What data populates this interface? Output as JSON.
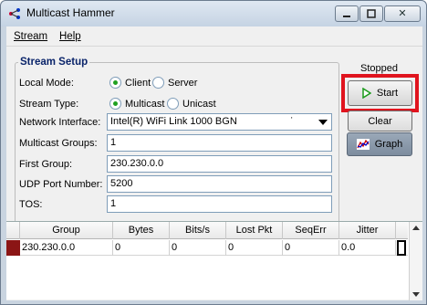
{
  "window": {
    "title": "Multicast Hammer",
    "close_label": "✕"
  },
  "menu": {
    "stream": "Stream",
    "help": "Help"
  },
  "stream_setup": {
    "title": "Stream Setup",
    "local_mode": {
      "label": "Local Mode:",
      "options": [
        "Client",
        "Server"
      ],
      "selected": "Client"
    },
    "stream_type": {
      "label": "Stream Type:",
      "options": [
        "Multicast",
        "Unicast"
      ],
      "selected": "Multicast"
    },
    "network_interface": {
      "label": "Network Interface:",
      "value": "Intel(R) WiFi Link 1000 BGN"
    },
    "multicast_groups": {
      "label": "Multicast Groups:",
      "value": "1"
    },
    "first_group": {
      "label": "First Group:",
      "value": "230.230.0.0"
    },
    "udp_port": {
      "label": "UDP Port Number:",
      "value": "5200"
    },
    "tos": {
      "label": "TOS:",
      "value": "1"
    }
  },
  "controls": {
    "status": "Stopped",
    "start_label": "Start",
    "clear_label": "Clear",
    "graph_label": "Graph",
    "highlight_color": "#e0141e"
  },
  "table": {
    "columns": [
      "Group",
      "Bytes",
      "Bits/s",
      "Lost Pkt",
      "SeqErr",
      "Jitter"
    ],
    "rows": [
      [
        "230.230.0.0",
        "0",
        "0",
        "0",
        "0",
        "0.0"
      ]
    ]
  }
}
